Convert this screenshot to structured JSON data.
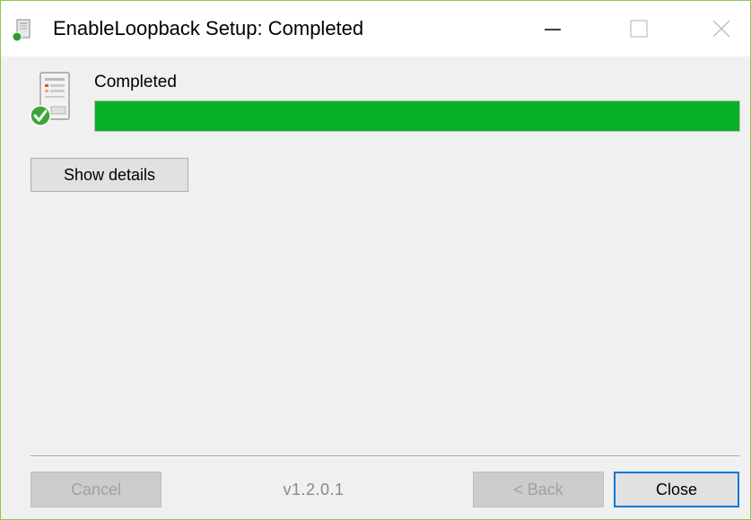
{
  "window": {
    "title": "EnableLoopback Setup: Completed",
    "app_icon": "installer-icon",
    "controls": [
      "minimize-icon",
      "maximize-icon",
      "close-icon"
    ]
  },
  "status": {
    "label": "Completed",
    "icon": "installer-completed-icon",
    "progress_percent": 100,
    "progress_color": "#06b025"
  },
  "buttons": {
    "show_details": "Show details",
    "cancel": "Cancel",
    "back": "< Back",
    "close": "Close"
  },
  "footer": {
    "version": "v1.2.0.1"
  },
  "colors": {
    "window_border": "#8cc84b",
    "focus_border": "#0078d7",
    "background": "#f0f0f0"
  }
}
